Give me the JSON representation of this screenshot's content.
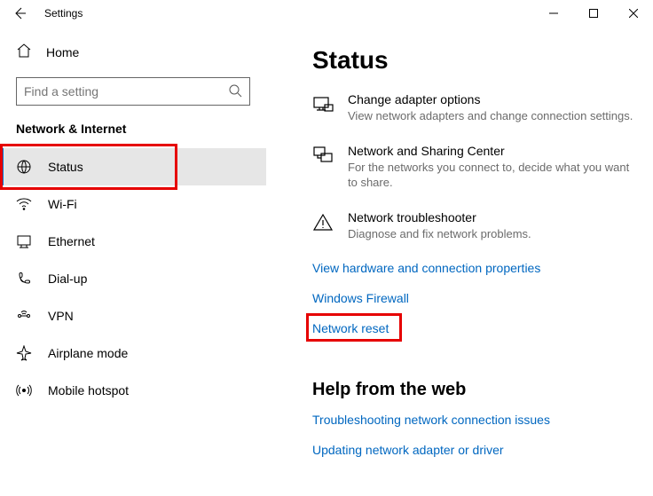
{
  "window": {
    "title": "Settings"
  },
  "sidebar": {
    "home": "Home",
    "search_placeholder": "Find a setting",
    "section": "Network & Internet",
    "items": [
      {
        "label": "Status"
      },
      {
        "label": "Wi-Fi"
      },
      {
        "label": "Ethernet"
      },
      {
        "label": "Dial-up"
      },
      {
        "label": "VPN"
      },
      {
        "label": "Airplane mode"
      },
      {
        "label": "Mobile hotspot"
      }
    ]
  },
  "main": {
    "title": "Status",
    "options": [
      {
        "title": "Change adapter options",
        "desc": "View network adapters and change connection settings."
      },
      {
        "title": "Network and Sharing Center",
        "desc": "For the networks you connect to, decide what you want to share."
      },
      {
        "title": "Network troubleshooter",
        "desc": "Diagnose and fix network problems."
      }
    ],
    "links": [
      "View hardware and connection properties",
      "Windows Firewall",
      "Network reset"
    ],
    "help_header": "Help from the web",
    "help_links": [
      "Troubleshooting network connection issues",
      "Updating network adapter or driver"
    ]
  }
}
